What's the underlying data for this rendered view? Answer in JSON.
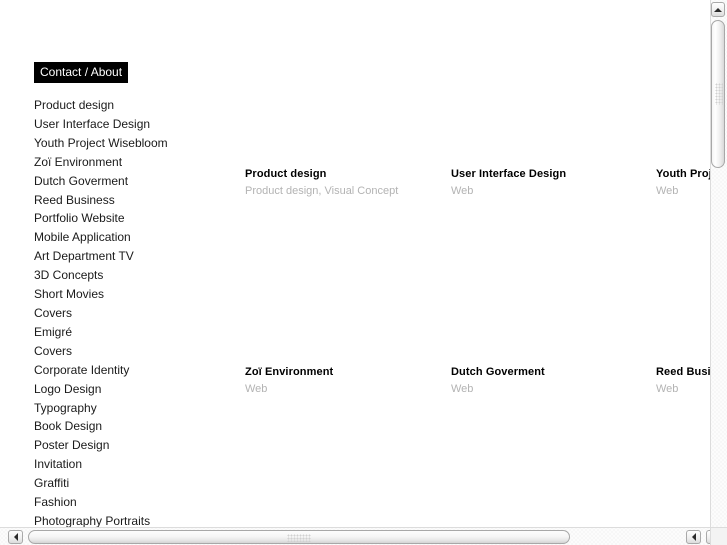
{
  "sidebar": {
    "current_label": "Contact / About",
    "items": [
      {
        "label": "Product design"
      },
      {
        "label": "User Interface Design"
      },
      {
        "label": "Youth Project Wisebloom"
      },
      {
        "label": "Zoï Environment"
      },
      {
        "label": "Dutch Goverment"
      },
      {
        "label": "Reed Business"
      },
      {
        "label": "Portfolio Website"
      },
      {
        "label": "Mobile Application"
      },
      {
        "label": "Art Department TV"
      },
      {
        "label": "3D Concepts"
      },
      {
        "label": "Short Movies"
      },
      {
        "label": "Covers"
      },
      {
        "label": "Emigré"
      },
      {
        "label": "Covers"
      },
      {
        "label": "Corporate Identity"
      },
      {
        "label": "Logo Design"
      },
      {
        "label": "Typography"
      },
      {
        "label": "Book Design"
      },
      {
        "label": "Poster Design"
      },
      {
        "label": "Invitation"
      },
      {
        "label": "Graffiti"
      },
      {
        "label": "Fashion"
      },
      {
        "label": "Photography Portraits"
      }
    ]
  },
  "projects": [
    {
      "title": "Product design",
      "meta": "Product design, Visual Concept"
    },
    {
      "title": "User Interface Design",
      "meta": "Web"
    },
    {
      "title": "Youth Proje",
      "meta": "Web"
    },
    {
      "title": "Zoï Environment",
      "meta": "Web"
    },
    {
      "title": "Dutch Goverment",
      "meta": "Web"
    },
    {
      "title": "Reed Busin",
      "meta": "Web"
    }
  ],
  "scrollbars": {
    "vertical": {
      "up_icon": "triangle-up-icon"
    },
    "horizontal": {
      "left_icon": "triangle-left-icon",
      "right_icon": "triangle-right-icon"
    }
  },
  "colors": {
    "highlight_bg": "#000000",
    "highlight_fg": "#ffffff",
    "nav_text": "#1a1a1a",
    "title": "#000000",
    "meta": "#b3b3b3",
    "page_bg": "#ffffff"
  }
}
